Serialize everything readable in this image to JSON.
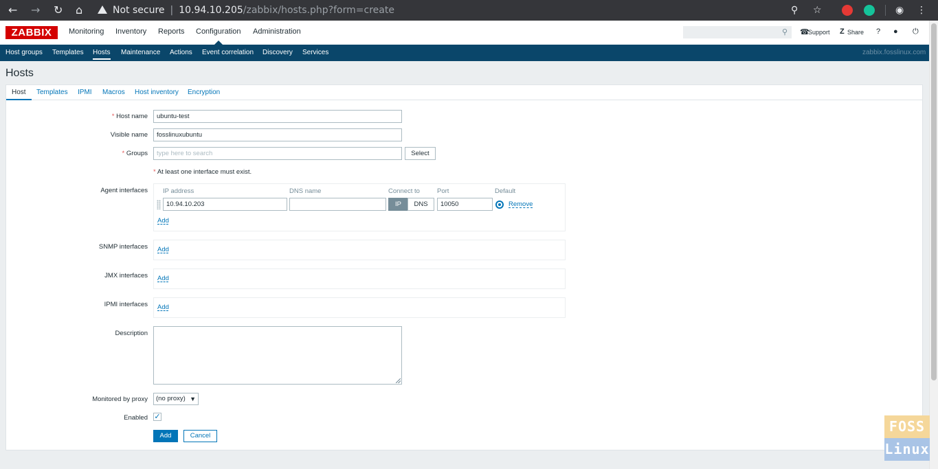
{
  "browser": {
    "security": "Not secure",
    "host": "10.94.10.205",
    "path": "/zabbix/hosts.php?form=create"
  },
  "brand": {
    "logo": "ZABBIX",
    "accent": "#d40000"
  },
  "main_menu": [
    "Monitoring",
    "Inventory",
    "Reports",
    "Configuration",
    "Administration"
  ],
  "top_links": {
    "support": "Support",
    "share": "Share",
    "help": "?"
  },
  "sub_menu": [
    "Host groups",
    "Templates",
    "Hosts",
    "Maintenance",
    "Actions",
    "Event correlation",
    "Discovery",
    "Services"
  ],
  "server_name": "zabbix.fosslinux.com",
  "page_title": "Hosts",
  "tabs": [
    "Host",
    "Templates",
    "IPMI",
    "Macros",
    "Host inventory",
    "Encryption"
  ],
  "form": {
    "host_name_label": "Host name",
    "host_name_value": "ubuntu-test",
    "visible_name_label": "Visible name",
    "visible_name_value": "fosslinuxubuntu",
    "groups_label": "Groups",
    "groups_placeholder": "type here to search",
    "select_button": "Select",
    "interface_note": "At least one interface must exist.",
    "agent_label": "Agent interfaces",
    "col_ip": "IP address",
    "col_dns": "DNS name",
    "col_connect": "Connect to",
    "col_port": "Port",
    "col_default": "Default",
    "agent_ip": "10.94.10.203",
    "agent_dns": "",
    "connect_ip": "IP",
    "connect_dns": "DNS",
    "agent_port": "10050",
    "remove_link": "Remove",
    "add_link": "Add",
    "snmp_label": "SNMP interfaces",
    "jmx_label": "JMX interfaces",
    "ipmi_label": "IPMI interfaces",
    "description_label": "Description",
    "proxy_label": "Monitored by proxy",
    "proxy_value": "(no proxy)",
    "enabled_label": "Enabled",
    "add_button": "Add",
    "cancel_button": "Cancel"
  },
  "watermark": {
    "line1": "FOSS",
    "line2": "Linux"
  }
}
